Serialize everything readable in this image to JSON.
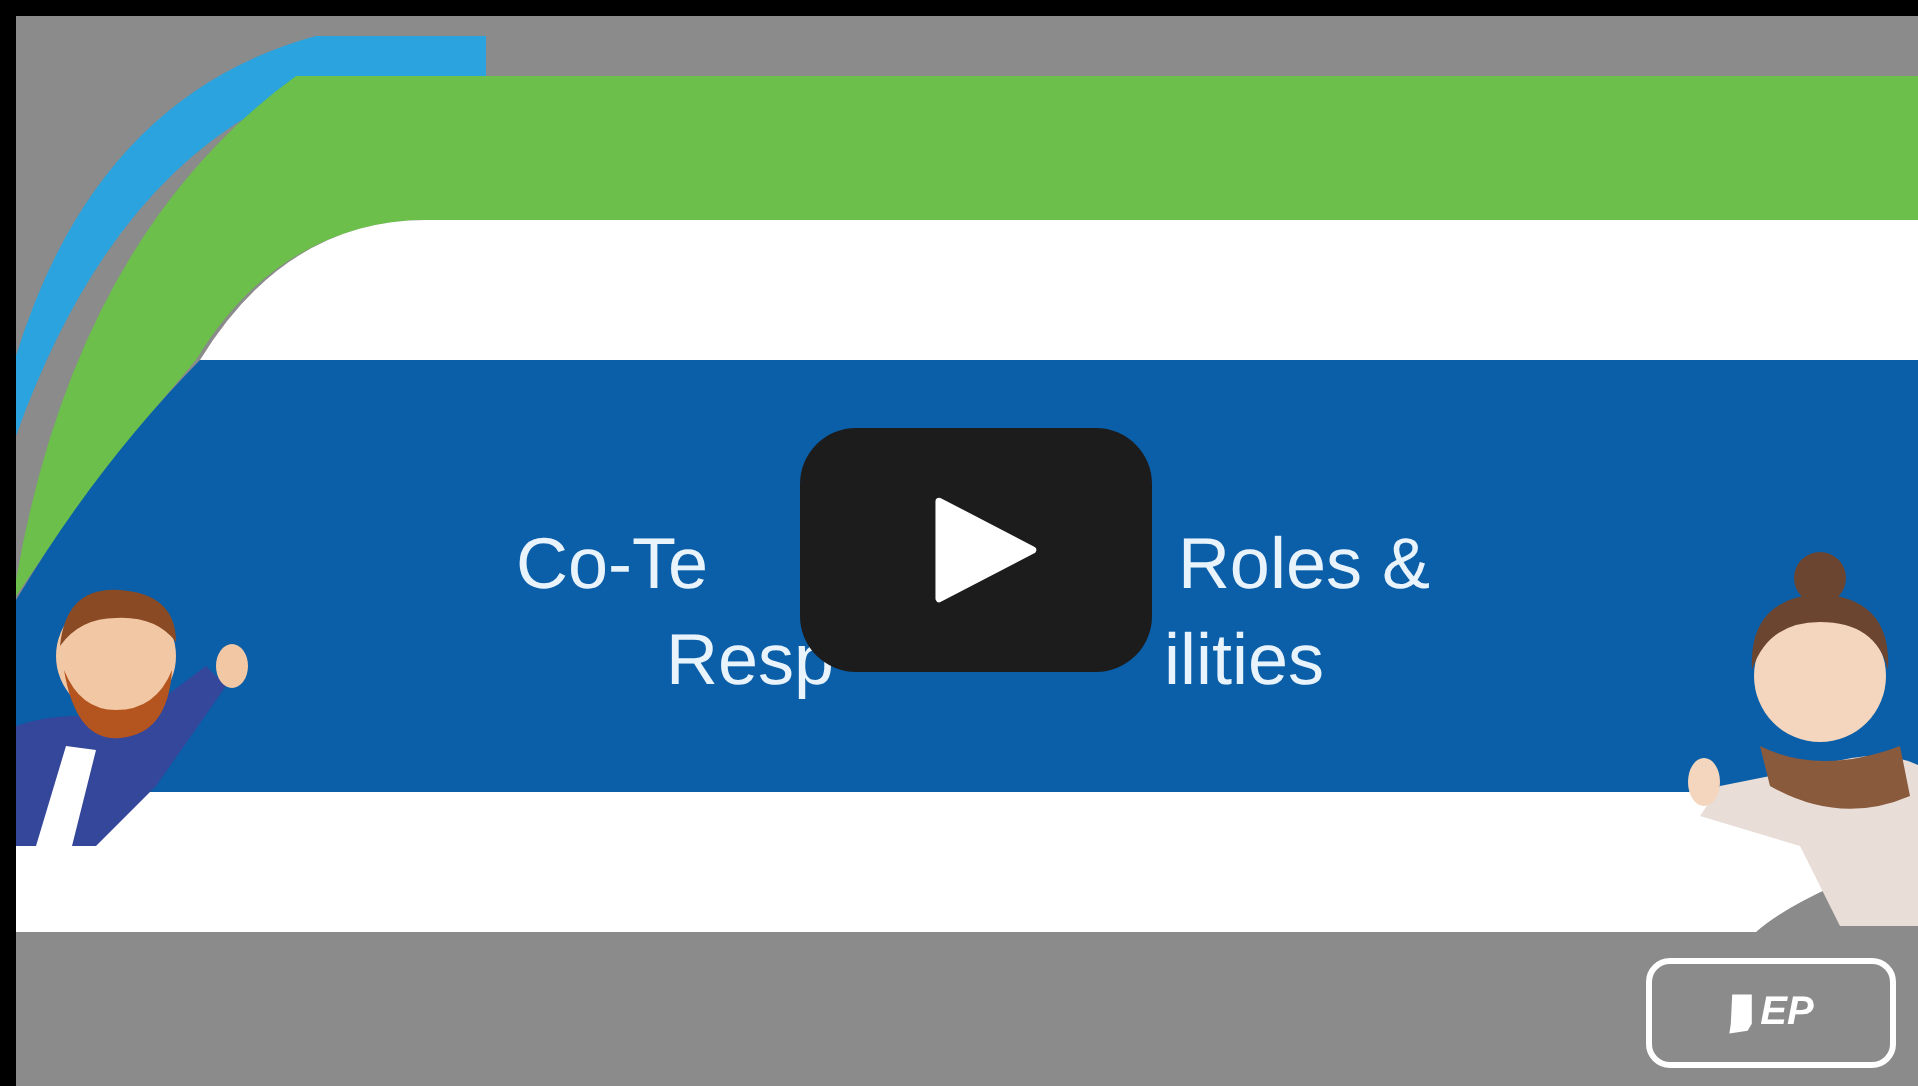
{
  "player": {
    "kind": "video"
  },
  "slide": {
    "title_lines": [
      {
        "left": "Co-Te",
        "right": "Roles &"
      },
      {
        "left": "Resp",
        "right": "ilities"
      }
    ]
  },
  "logo": {
    "text": "EP"
  }
}
